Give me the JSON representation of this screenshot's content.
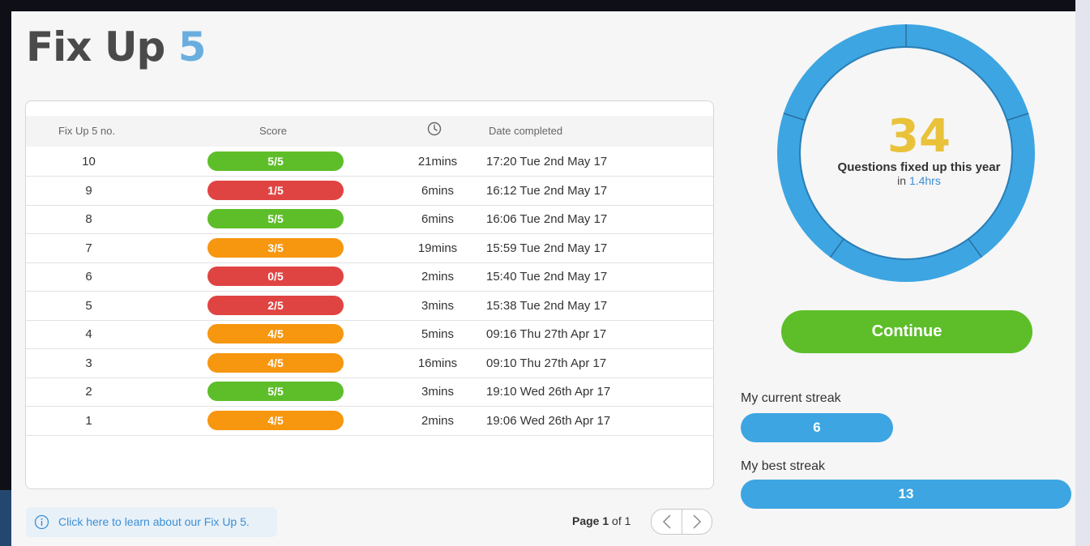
{
  "title": {
    "text": "Fix Up",
    "number": "5"
  },
  "table": {
    "headers": {
      "no": "Fix Up 5 no.",
      "score": "Score",
      "time_icon": "clock-icon",
      "date": "Date completed"
    },
    "rows": [
      {
        "no": "10",
        "score": "5/5",
        "status": "green",
        "time": "21mins",
        "date": "17:20 Tue 2nd May 17"
      },
      {
        "no": "9",
        "score": "1/5",
        "status": "red",
        "time": "6mins",
        "date": "16:12 Tue 2nd May 17"
      },
      {
        "no": "8",
        "score": "5/5",
        "status": "green",
        "time": "6mins",
        "date": "16:06 Tue 2nd May 17"
      },
      {
        "no": "7",
        "score": "3/5",
        "status": "orange",
        "time": "19mins",
        "date": "15:59 Tue 2nd May 17"
      },
      {
        "no": "6",
        "score": "0/5",
        "status": "red",
        "time": "2mins",
        "date": "15:40 Tue 2nd May 17"
      },
      {
        "no": "5",
        "score": "2/5",
        "status": "red",
        "time": "3mins",
        "date": "15:38 Tue 2nd May 17"
      },
      {
        "no": "4",
        "score": "4/5",
        "status": "orange",
        "time": "5mins",
        "date": "09:16 Thu 27th Apr 17"
      },
      {
        "no": "3",
        "score": "4/5",
        "status": "orange",
        "time": "16mins",
        "date": "09:10 Thu 27th Apr 17"
      },
      {
        "no": "2",
        "score": "5/5",
        "status": "green",
        "time": "3mins",
        "date": "19:10 Wed 26th Apr 17"
      },
      {
        "no": "1",
        "score": "4/5",
        "status": "orange",
        "time": "2mins",
        "date": "19:06 Wed 26th Apr 17"
      }
    ]
  },
  "colors": {
    "green": "#5dbe2a",
    "red": "#e04442",
    "orange": "#f7960f",
    "blue": "#3da5e2",
    "yellow": "#e9c23a"
  },
  "info": {
    "icon": "info-icon",
    "text": "Click here to learn about our Fix Up 5."
  },
  "pagination": {
    "page_label": "Page",
    "current": "1",
    "of_label": "of",
    "total": "1",
    "prev_icon": "chevron-left-icon",
    "next_icon": "chevron-right-icon"
  },
  "summary": {
    "questions_fixed": "34",
    "label": "Questions fixed up this year",
    "in_label": "in",
    "hours": "1.4hrs"
  },
  "continue_label": "Continue",
  "streaks": {
    "current": {
      "label": "My current streak",
      "value": "6"
    },
    "best": {
      "label": "My best streak",
      "value": "13"
    }
  }
}
